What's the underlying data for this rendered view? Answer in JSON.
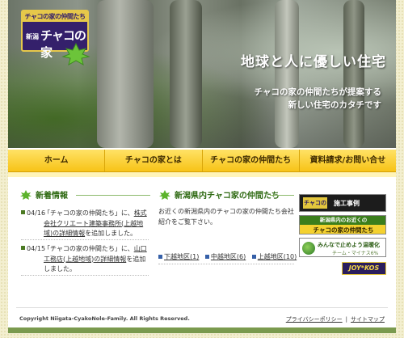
{
  "logo": {
    "tagline": "チャコの家の仲間たち",
    "region": "新潟",
    "name": "チャコの家"
  },
  "hero": {
    "headline": "地球と人に優しい住宅",
    "subline_1": "チャコの家の仲間たちが提案する",
    "subline_2": "新しい住宅のカタチです"
  },
  "nav": {
    "items": [
      {
        "label": "ホーム"
      },
      {
        "label": "チャコの家とは"
      },
      {
        "label": "チャコの家の仲間たち"
      },
      {
        "label": "資料請求/お問い合せ"
      }
    ]
  },
  "news": {
    "title": "新着情報",
    "items": [
      {
        "date": "04/16",
        "text_before": "「チャコの家の仲間たち」に、",
        "link": "株式会社クリエート建築事務所(上越地域)の詳細情報",
        "text_after": "を追加しました。"
      },
      {
        "date": "04/15",
        "text_before": "「チャコの家の仲間たち」に、",
        "link": "山口工務店(上越地域)の詳細情報",
        "text_after": "を追加しました。"
      }
    ]
  },
  "members": {
    "title": "新潟県内チャコ家の仲間たち",
    "intro": "お近くの新潟県内のチャコの家の仲間たち会社紹介をご覧下さい。",
    "regions": [
      {
        "label": "下越地区(1)"
      },
      {
        "label": "中越地区(6)"
      },
      {
        "label": "上越地区(10)"
      }
    ]
  },
  "banners": {
    "case_logo": "チャコの家",
    "case_label": "施工事例",
    "nearby_top": "新潟県内のお近くの",
    "nearby_bottom": "チャコの家の仲間たち",
    "eco_title": "みんなで止めよう温暖化",
    "eco_sub": "チーム・マイナス6%",
    "joykos": "JOY*KOS"
  },
  "footer": {
    "copyright": "Copyright Niigata-CyakoNole-Family. All Rights Reserved.",
    "privacy": "プライバシーポリシー",
    "sitemap": "サイトマップ",
    "separator": "|"
  },
  "colors": {
    "nav_yellow": "#f7c317",
    "leaf_green": "#2f6a13",
    "logo_purple": "#34206b"
  }
}
